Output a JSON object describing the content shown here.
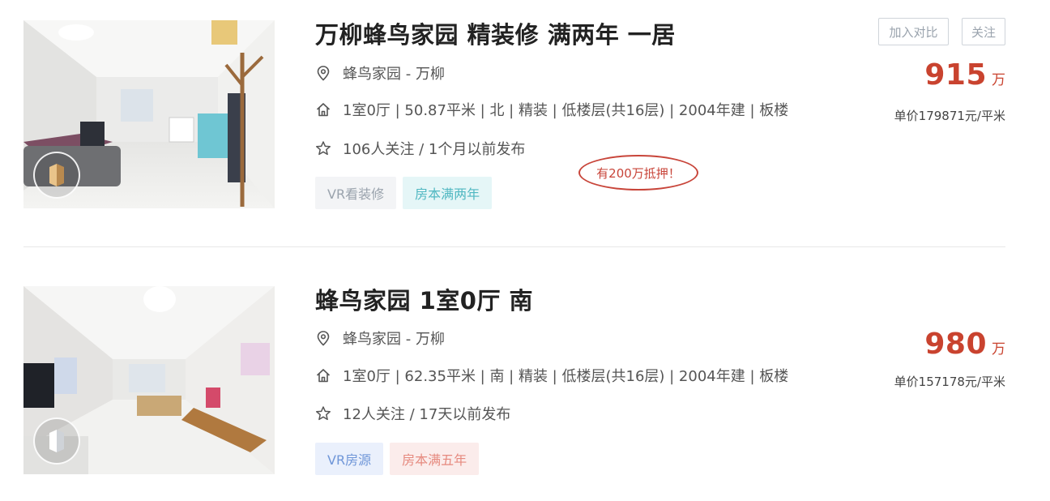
{
  "listings": [
    {
      "title": "万柳蜂鸟家园 精装修 满两年 一居",
      "location": "蜂鸟家园 - 万柳",
      "info": "1室0厅 | 50.87平米 | 北 | 精装 | 低楼层(共16层) | 2004年建 | 板楼",
      "follow": "106人关注 / 1个月以前发布",
      "tags": [
        "VR看装修",
        "房本满两年"
      ],
      "price": "915",
      "price_unit": "万",
      "unit_price": "单价179871元/平米",
      "note": "有200万抵押！",
      "buttons": {
        "compare": "加入对比",
        "follow": "关注"
      }
    },
    {
      "title": "蜂鸟家园 1室0厅 南",
      "location": "蜂鸟家园 - 万柳",
      "info": "1室0厅 | 62.35平米 | 南 | 精装 | 低楼层(共16层) | 2004年建 | 板楼",
      "follow": "12人关注 / 17天以前发布",
      "tags": [
        "VR房源",
        "房本满五年"
      ],
      "price": "980",
      "price_unit": "万",
      "unit_price": "单价157178元/平米"
    }
  ],
  "colors": {
    "price": "#c9432f",
    "note": "#c8453a",
    "tag_teal": "#51b8c2",
    "tag_blue": "#6f96d8",
    "tag_pink": "#e68a7f"
  },
  "icons": [
    "location-pin-icon",
    "house-icon",
    "star-icon",
    "vr-badge-icon"
  ]
}
